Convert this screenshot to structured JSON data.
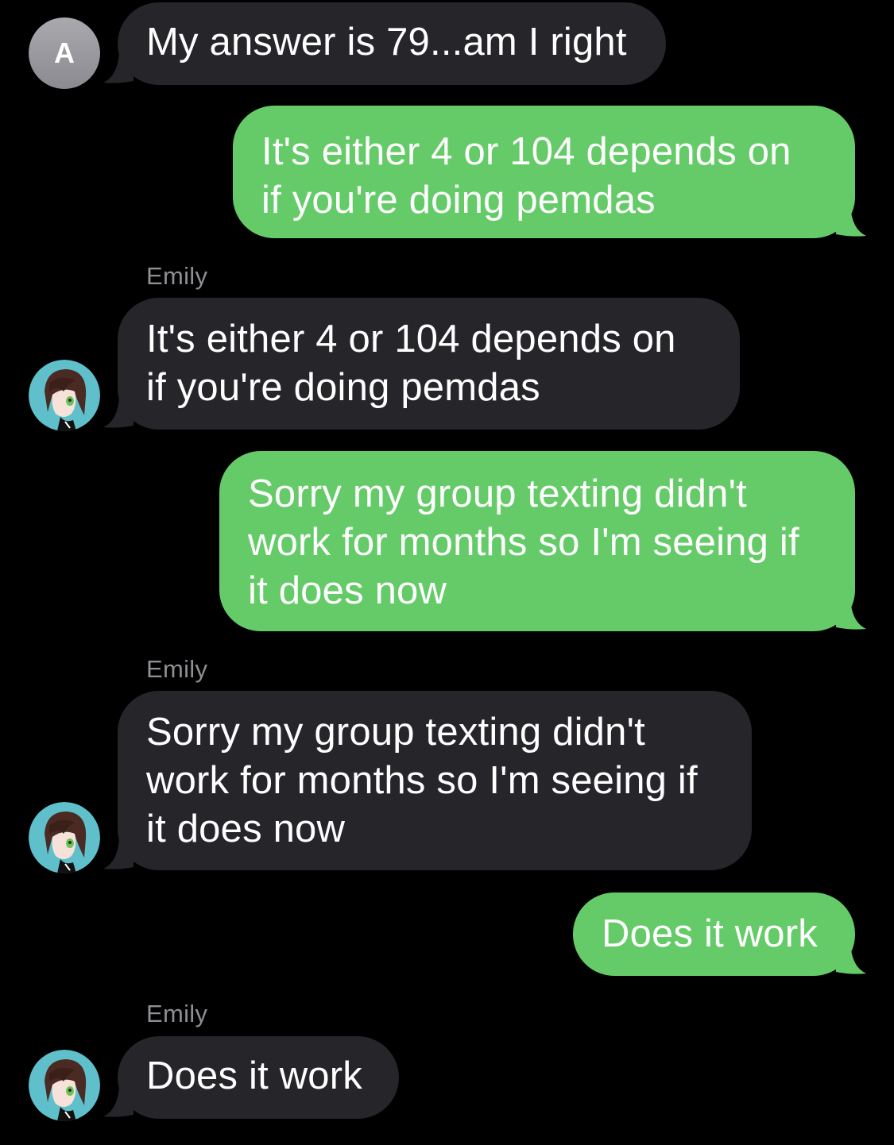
{
  "messages": [
    {
      "direction": "incoming",
      "avatar_letter": "A",
      "lines": [
        "My answer is 79...am I right"
      ]
    },
    {
      "direction": "outgoing",
      "lines": [
        "It's either 4 or 104 depends on",
        "if you're doing pemdas"
      ]
    },
    {
      "direction": "incoming",
      "sender": "Emily",
      "lines": [
        "It's either 4 or 104 depends on",
        "if you're doing pemdas"
      ]
    },
    {
      "direction": "outgoing",
      "lines": [
        "Sorry my group texting didn't",
        "work for months so I'm seeing if",
        "it does now"
      ]
    },
    {
      "direction": "incoming",
      "sender": "Emily",
      "lines": [
        "Sorry my group texting didn't",
        "work for months so I'm seeing if",
        "it does now"
      ]
    },
    {
      "direction": "outgoing",
      "lines": [
        "Does it work"
      ]
    },
    {
      "direction": "incoming",
      "sender": "Emily",
      "lines": [
        "Does it work"
      ]
    }
  ],
  "colors": {
    "background": "#000000",
    "incoming_bubble": "#26252a",
    "outgoing_bubble": "#65cb68",
    "sender_label": "#8e8e93",
    "bubble_text": "#ffffff"
  },
  "icons": {
    "contact_avatar": "letter-avatar-icon",
    "emily_avatar": "anime-girl-avatar-icon"
  }
}
